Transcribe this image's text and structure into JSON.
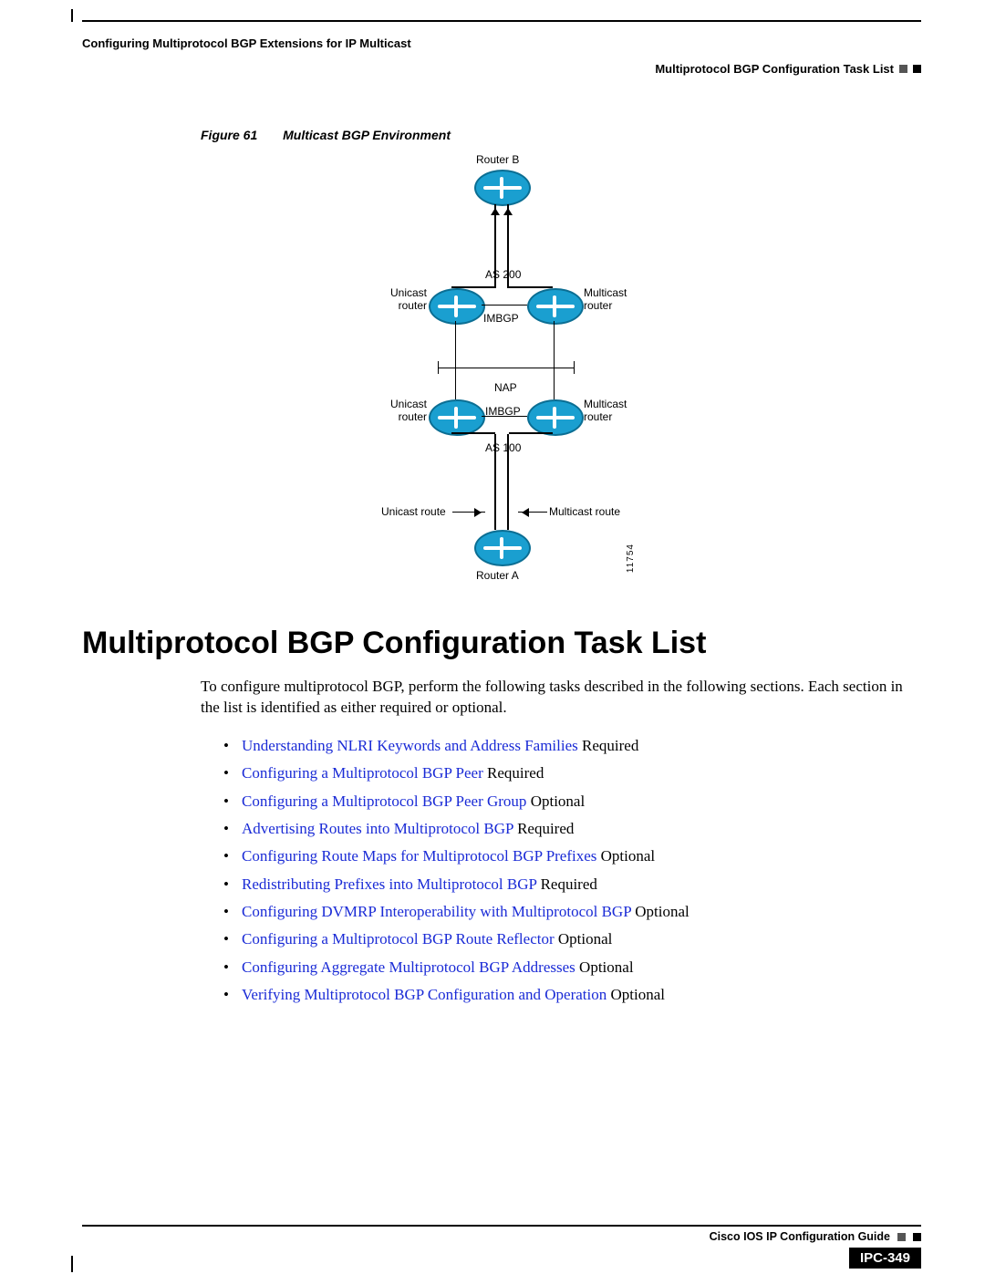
{
  "header": {
    "chapter": "Configuring Multiprotocol BGP Extensions for IP Multicast",
    "section": "Multiprotocol BGP Configuration Task List"
  },
  "figure": {
    "label": "Figure 61",
    "title": "Multicast BGP Environment",
    "router_b": "Router B",
    "router_a": "Router A",
    "as200": "AS 200",
    "as100": "AS 100",
    "imbgp": "IMBGP",
    "nap": "NAP",
    "unicast_router": "Unicast\nrouter",
    "multicast_router": "Multicast\nrouter",
    "unicast_route": "Unicast route",
    "multicast_route": "Multicast route",
    "id": "11754"
  },
  "section_title": "Multiprotocol BGP Configuration Task List",
  "intro": "To configure multiprotocol BGP, perform the following tasks described in the following sections. Each section in the list is identified as either required or optional.",
  "tasks": [
    {
      "link": "Understanding NLRI Keywords and Address Families",
      "tag": " Required"
    },
    {
      "link": "Configuring a Multiprotocol BGP Peer",
      "tag": " Required"
    },
    {
      "link": "Configuring a Multiprotocol BGP Peer Group",
      "tag": " Optional"
    },
    {
      "link": "Advertising Routes into Multiprotocol BGP",
      "tag": " Required"
    },
    {
      "link": "Configuring Route Maps for Multiprotocol BGP Prefixes",
      "tag": " Optional"
    },
    {
      "link": "Redistributing Prefixes into Multiprotocol BGP",
      "tag": " Required"
    },
    {
      "link": "Configuring DVMRP Interoperability with Multiprotocol BGP",
      "tag": " Optional"
    },
    {
      "link": "Configuring a Multiprotocol BGP Route Reflector",
      "tag": " Optional"
    },
    {
      "link": "Configuring Aggregate Multiprotocol BGP Addresses",
      "tag": " Optional"
    },
    {
      "link": "Verifying Multiprotocol BGP Configuration and Operation",
      "tag": " Optional"
    }
  ],
  "footer": {
    "guide": "Cisco IOS IP Configuration Guide",
    "page": "IPC-349"
  }
}
